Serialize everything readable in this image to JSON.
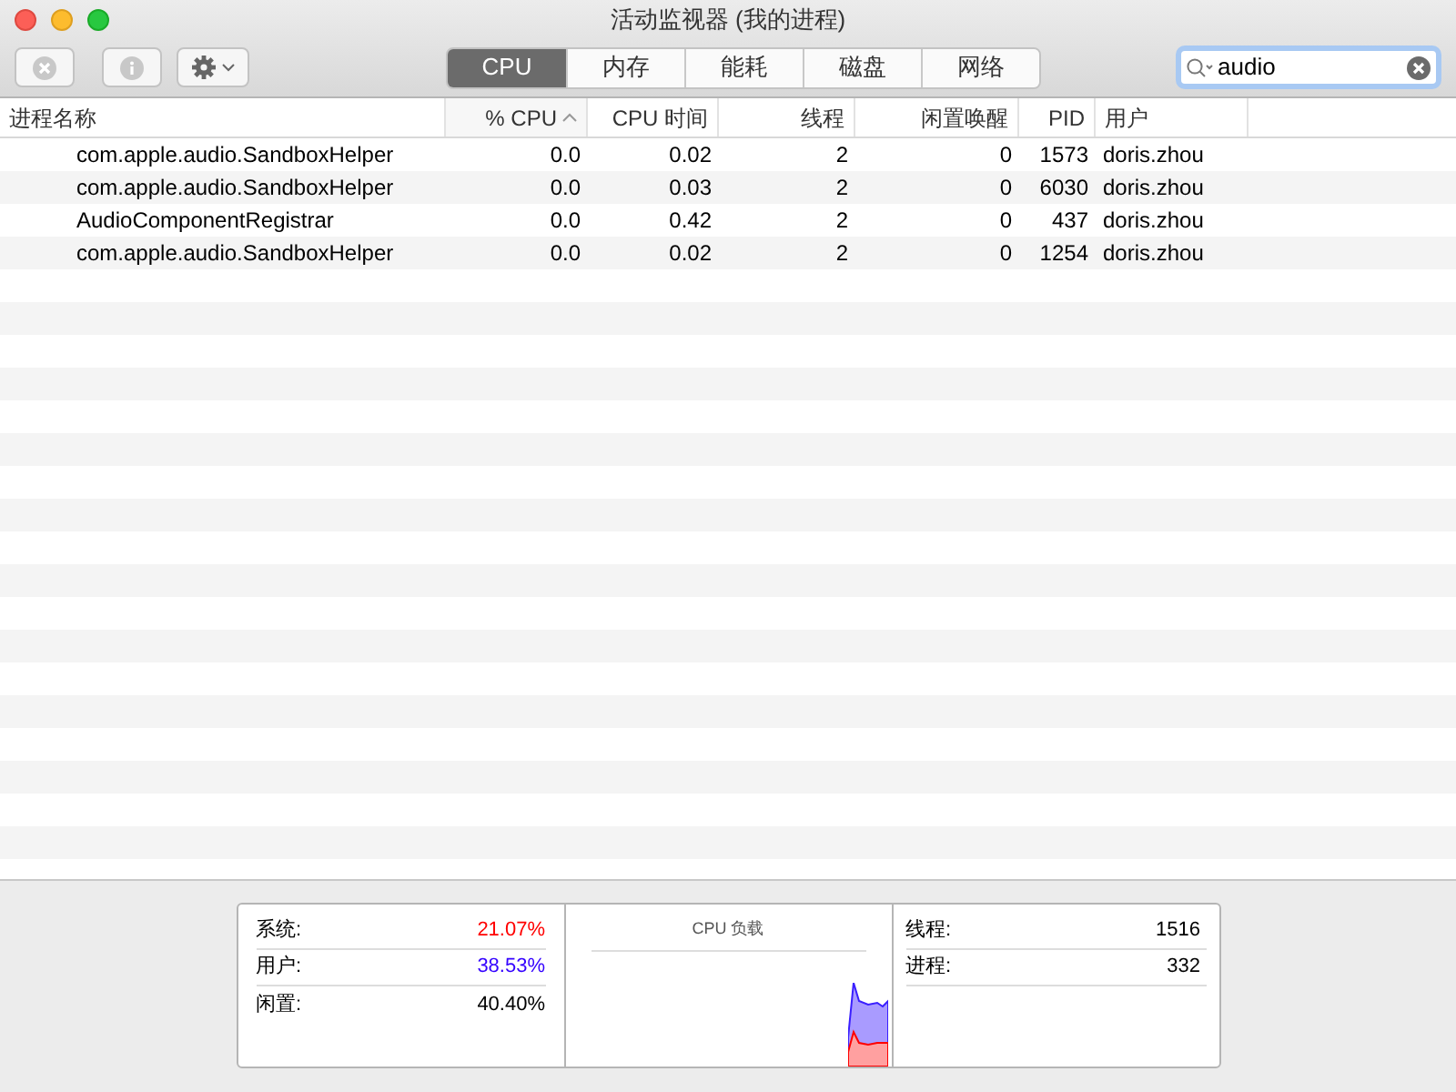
{
  "window": {
    "title": "活动监视器 (我的进程)"
  },
  "tabs": [
    {
      "label": "CPU",
      "selected": true
    },
    {
      "label": "内存",
      "selected": false
    },
    {
      "label": "能耗",
      "selected": false
    },
    {
      "label": "磁盘",
      "selected": false
    },
    {
      "label": "网络",
      "selected": false
    }
  ],
  "search": {
    "value": "audio"
  },
  "table": {
    "columns": [
      {
        "label": "进程名称",
        "sorted": false
      },
      {
        "label": "% CPU",
        "sorted": true
      },
      {
        "label": "CPU 时间",
        "sorted": false
      },
      {
        "label": "线程",
        "sorted": false
      },
      {
        "label": "闲置唤醒",
        "sorted": false
      },
      {
        "label": "PID",
        "sorted": false
      },
      {
        "label": "用户",
        "sorted": false
      }
    ],
    "rows": [
      {
        "cells": [
          "com.apple.audio.SandboxHelper",
          "0.0",
          "0.02",
          "2",
          "0",
          "1573",
          "doris.zhou"
        ]
      },
      {
        "cells": [
          "com.apple.audio.SandboxHelper",
          "0.0",
          "0.03",
          "2",
          "0",
          "6030",
          "doris.zhou"
        ]
      },
      {
        "cells": [
          "AudioComponentRegistrar",
          "0.0",
          "0.42",
          "2",
          "0",
          "437",
          "doris.zhou"
        ]
      },
      {
        "cells": [
          "com.apple.audio.SandboxHelper",
          "0.0",
          "0.02",
          "2",
          "0",
          "1254",
          "doris.zhou"
        ]
      }
    ]
  },
  "stats": [
    {
      "label": "系统:",
      "value": "21.07%",
      "color": "#ff0000"
    },
    {
      "label": "用户:",
      "value": "38.53%",
      "color": "#3300ff"
    },
    {
      "label": "闲置:",
      "value": "40.40%",
      "color": "#000000"
    }
  ],
  "chart": {
    "title": "CPU 负载"
  },
  "counts": [
    {
      "label": "线程:",
      "value": "1516"
    },
    {
      "label": "进程:",
      "value": "332"
    }
  ]
}
